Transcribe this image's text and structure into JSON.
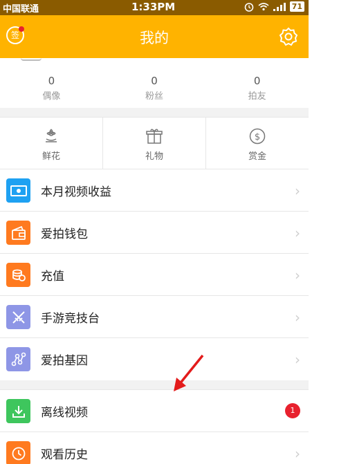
{
  "status_bar": {
    "carrier": "中国联通",
    "time": "1:33PM",
    "battery": "71"
  },
  "header": {
    "title": "我的",
    "sign_label": "签"
  },
  "stats": [
    {
      "value": "0",
      "label": "偶像"
    },
    {
      "value": "0",
      "label": "粉丝"
    },
    {
      "value": "0",
      "label": "拍友"
    }
  ],
  "gifts": [
    {
      "label": "鲜花",
      "icon": "flower-icon"
    },
    {
      "label": "礼物",
      "icon": "gift-icon"
    },
    {
      "label": "赏金",
      "icon": "coin-icon"
    }
  ],
  "menu": [
    {
      "label": "本月视频收益",
      "icon": "money-icon",
      "color": "#1ea1f2"
    },
    {
      "label": "爱拍钱包",
      "icon": "wallet-icon",
      "color": "#ff7a1f"
    },
    {
      "label": "充值",
      "icon": "coins-icon",
      "color": "#ff7a1f"
    },
    {
      "label": "手游竞技台",
      "icon": "swords-icon",
      "color": "#8e96e6"
    },
    {
      "label": "爱拍基因",
      "icon": "gene-icon",
      "color": "#8e96e6"
    }
  ],
  "menu2": [
    {
      "label": "离线视频",
      "icon": "download-icon",
      "color": "#3ec65d",
      "badge": "1"
    },
    {
      "label": "观看历史",
      "icon": "history-icon",
      "color": "#ff7a1f"
    }
  ],
  "colors": {
    "brand": "#ffb300",
    "status_bar": "#8a5b00",
    "badge": "#e8212e"
  }
}
